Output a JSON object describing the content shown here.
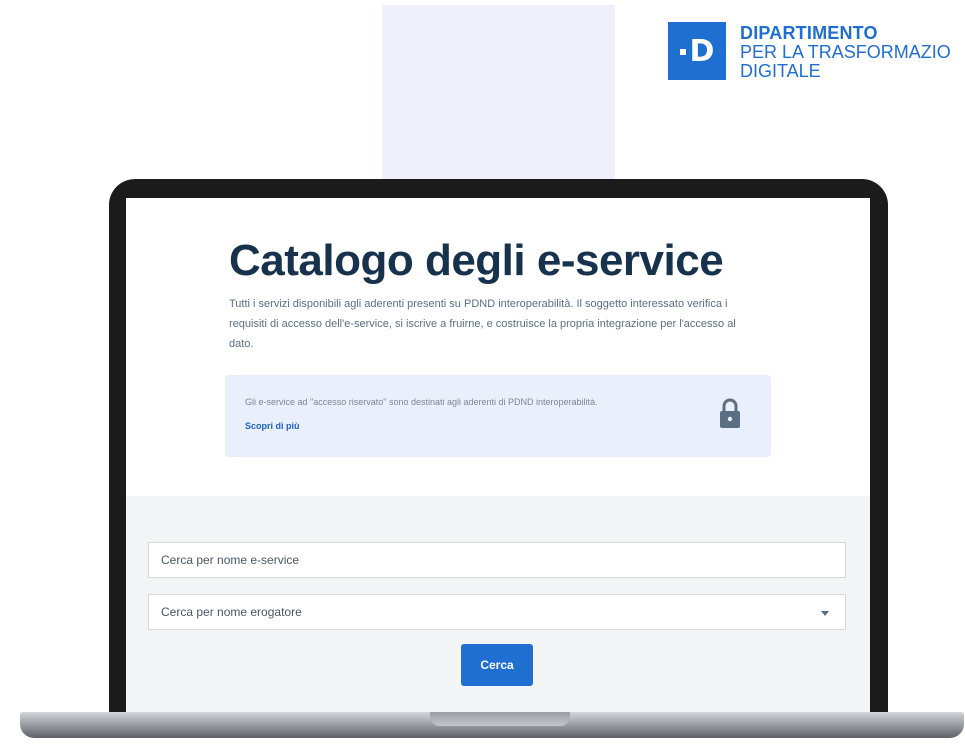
{
  "brand": {
    "mark": "D",
    "line1": "DIPARTIMENTO",
    "line2": "PER LA TRASFORMAZIO",
    "line3": "DIGITALE"
  },
  "page": {
    "title": "Catalogo degli e-service",
    "intro": "Tutti i servizi disponibili agli aderenti presenti su PDND interoperabilità. Il soggetto interessato verifica i requisiti di accesso dell'e-service, si iscrive a fruirne, e costruisce la propria integrazione per l'accesso al dato."
  },
  "notice": {
    "text": "Gli e-service ad \"accesso riservato\" sono destinati agli aderenti di PDND interoperabilità.",
    "link": "Scopri di più",
    "icon": "lock-icon"
  },
  "filters": {
    "service_placeholder": "Cerca per nome e-service",
    "provider_label": "Cerca per nome erogatore",
    "search_label": "Cerca"
  },
  "colors": {
    "brand_blue": "#1f6fd1",
    "title": "#17324d",
    "notice_bg": "#e9f0fb",
    "filters_bg": "#f4f5f7"
  }
}
